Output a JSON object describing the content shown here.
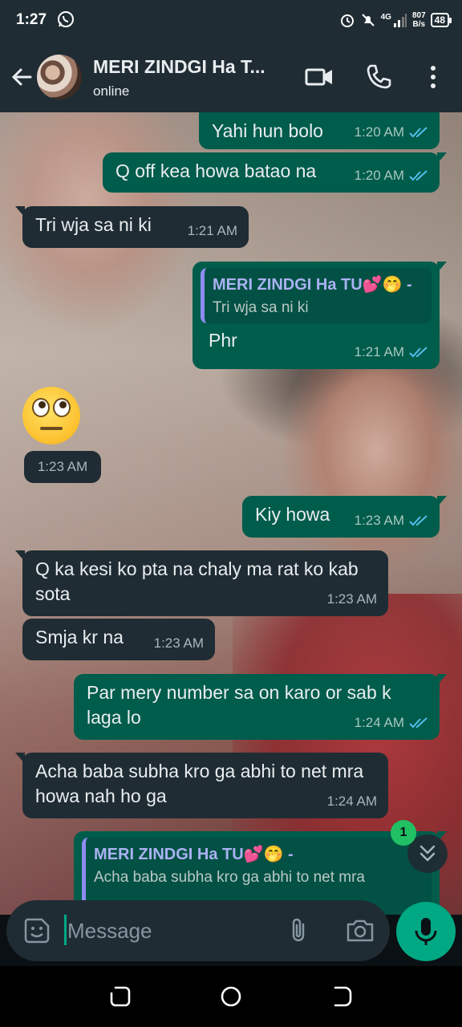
{
  "status_bar": {
    "time": "1:27",
    "network_type": "4G",
    "net_speed_value": "807",
    "net_speed_unit": "B/s",
    "battery": "48"
  },
  "header": {
    "contact_name": "MERI ZINDGI Ha T...",
    "status": "online"
  },
  "messages": [
    {
      "dir": "out",
      "text": "Yahi hun bolo",
      "time": "1:20 AM"
    },
    {
      "dir": "out",
      "text": "Q off kea howa batao na",
      "time": "1:20 AM"
    },
    {
      "dir": "in",
      "text": "Tri wja sa ni ki",
      "time": "1:21 AM"
    },
    {
      "dir": "out",
      "quote_author": "MERI ZINDGI Ha TU💕🤭 -",
      "quote_text": "Tri wja sa ni ki",
      "text": "Phr",
      "time": "1:21 AM"
    },
    {
      "dir": "in",
      "emoji_name": "face-with-rolling-eyes",
      "time": "1:23 AM"
    },
    {
      "dir": "out",
      "text": "Kiy howa",
      "time": "1:23 AM"
    },
    {
      "dir": "in",
      "text": "Q ka kesi ko pta na chaly ma rat ko kab sota",
      "time": "1:23 AM"
    },
    {
      "dir": "in",
      "text": "Smja kr na",
      "time": "1:23 AM"
    },
    {
      "dir": "out",
      "text": "Par mery number sa on karo or sab k laga lo",
      "time": "1:24 AM"
    },
    {
      "dir": "in",
      "text": "Acha baba subha kro ga abhi to net mra howa nah ho ga",
      "time": "1:24 AM"
    },
    {
      "dir": "out",
      "quote_author": "MERI ZINDGI Ha TU💕🤭 -",
      "quote_text": "Acha baba subha kro ga abhi to net mra"
    }
  ],
  "scroll_down": {
    "unread_count": "1"
  },
  "composer": {
    "placeholder": "Message"
  },
  "colors": {
    "header_bg": "#1f2c34",
    "outgoing_bubble": "#005c4b",
    "incoming_bubble": "#1f2c34",
    "accent_green": "#00a884",
    "read_tick": "#53bdeb"
  },
  "icons": [
    "whatsapp-icon",
    "alarm-icon",
    "mute-icon",
    "signal-icon",
    "battery-icon",
    "back-arrow-icon",
    "video-call-icon",
    "phone-icon",
    "more-vert-icon",
    "double-check-icon",
    "chevron-double-down-icon",
    "sticker-emoji-icon",
    "attach-icon",
    "camera-icon",
    "mic-icon",
    "recents-icon",
    "home-icon",
    "back-nav-icon"
  ]
}
